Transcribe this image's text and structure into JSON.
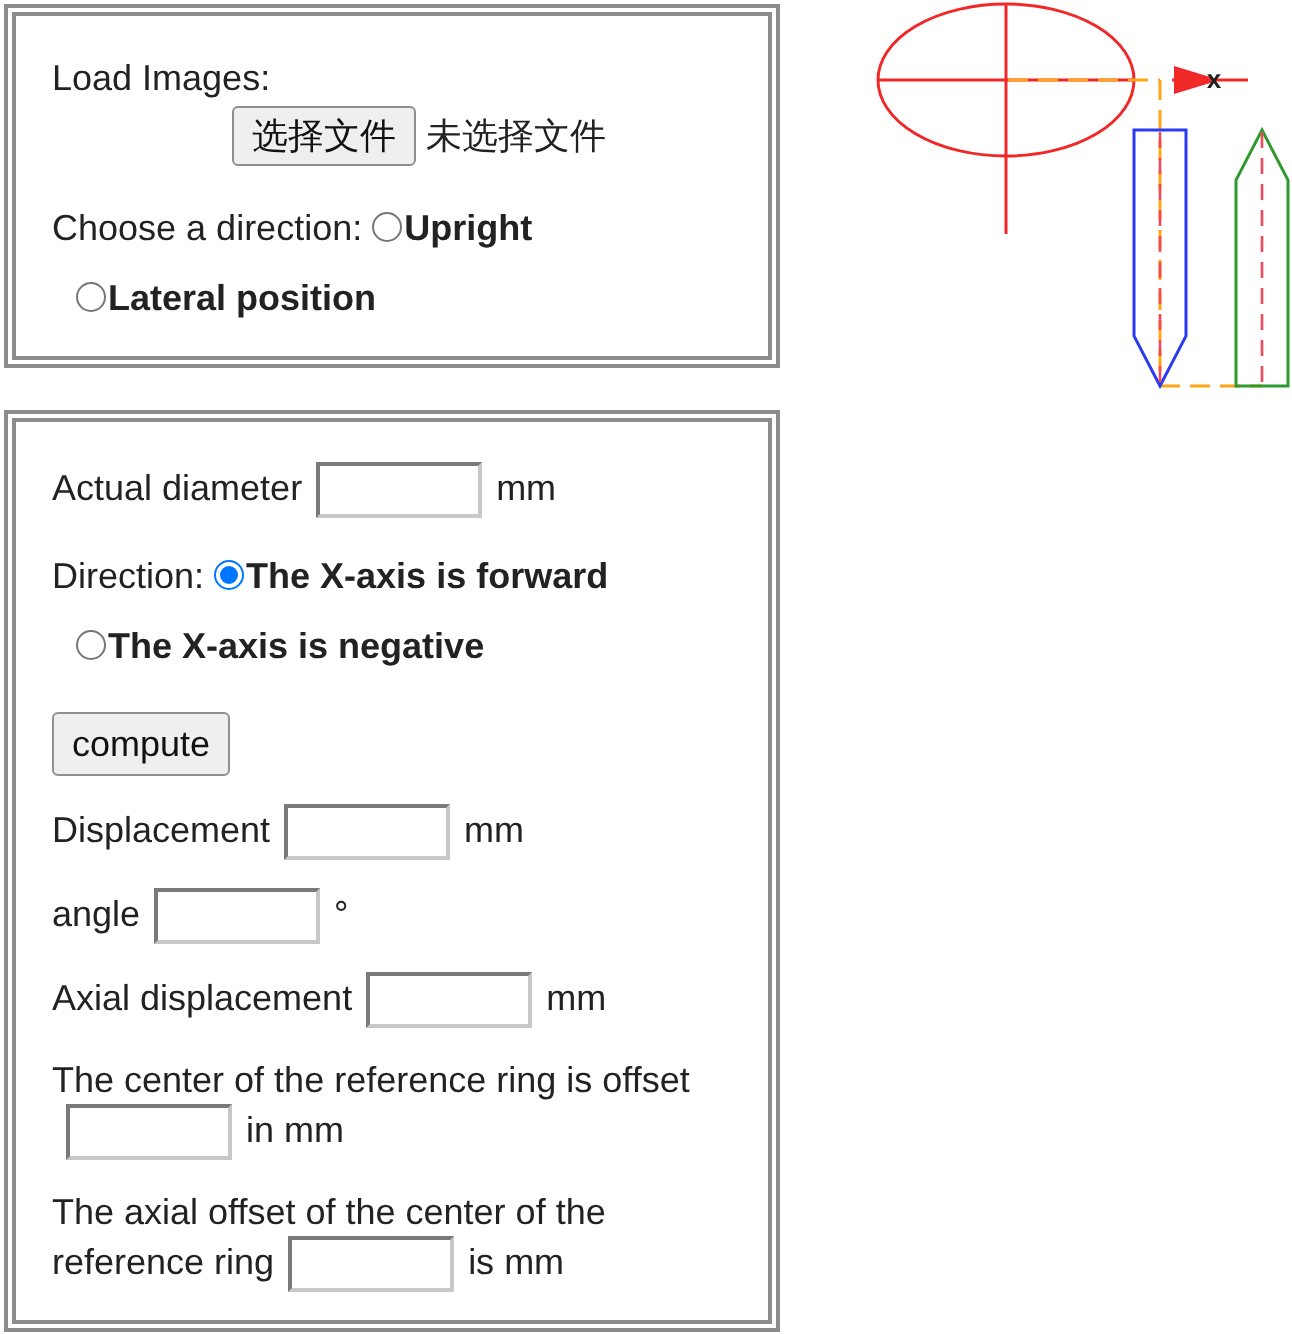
{
  "upload_panel": {
    "title": "Load Images:",
    "file_button": "选择文件",
    "file_status": "未选择文件",
    "direction_label": "Choose a direction:",
    "options": [
      {
        "label": "Upright",
        "selected": false
      },
      {
        "label": "Lateral position",
        "selected": false
      }
    ]
  },
  "diagram": {
    "axis_label": "x"
  },
  "measure_panel": {
    "diameter": {
      "label": "Actual diameter",
      "unit": "mm"
    },
    "direction_label": "Direction:",
    "options": [
      {
        "label": "The X-axis is forward",
        "selected": true
      },
      {
        "label": "The X-axis is negative",
        "selected": false
      }
    ],
    "compute_button": "compute",
    "results": [
      {
        "label_lines": [
          "Displacement"
        ],
        "unit": "mm"
      },
      {
        "label_lines": [
          "angle"
        ],
        "unit": "°"
      },
      {
        "label_lines": [
          "Axial displacement"
        ],
        "unit": "mm"
      },
      {
        "label_lines": [
          "The center of the reference ring is offset"
        ],
        "unit": "in mm"
      },
      {
        "label_lines": [
          "The axial offset of the center of the",
          "reference ring"
        ],
        "unit": "is mm"
      }
    ]
  }
}
